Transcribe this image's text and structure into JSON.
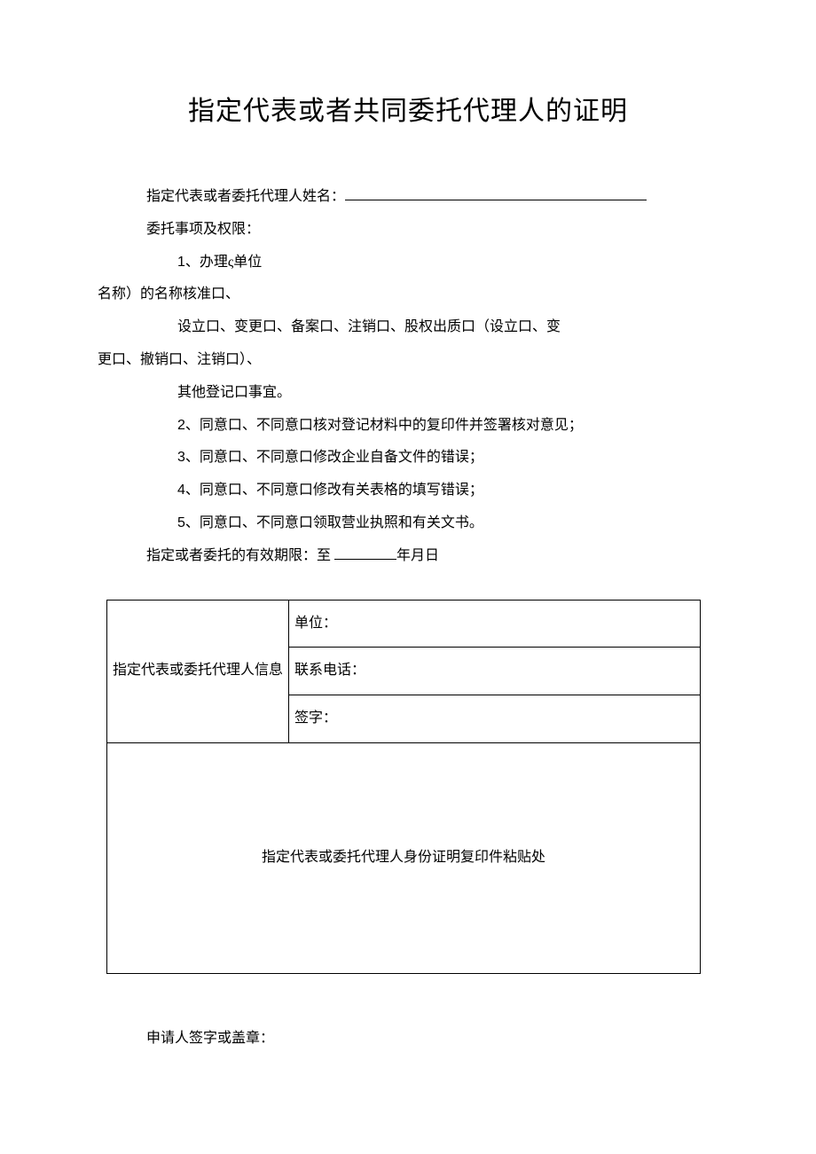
{
  "title": "指定代表或者共同委托代理人的证明",
  "lines": {
    "name_label": "指定代表或者委托代理人姓名：",
    "entrust_label": "委托事项及权限：",
    "item1_a": "1、办理ς单位",
    "item1_b": "名称）的名称核准口、",
    "item1_c": "设立口、变更口、备案口、注销口、股权出质口（设立口、变",
    "item1_d": "更口、撤销口、注销口）、",
    "item1_e": "其他登记口事宜。",
    "item2": "2、同意口、不同意口核对登记材料中的复印件并签署核对意见；",
    "item3": "3、同意口、不同意口修改企业自备文件的错误；",
    "item4": "4、同意口、不同意口修改有关表格的填写错误；",
    "item5": "5、同意口、不同意口领取营业执照和有关文书。",
    "term_a": "指定或者委托的有效期限：至 ",
    "term_b": "年月日"
  },
  "table": {
    "header": "指定代表或委托代理人信息",
    "unit": "单位：",
    "phone": "联系电话：",
    "sign": "签字：",
    "paste": "指定代表或委托代理人身份证明复印件粘贴处"
  },
  "footer": "申请人签字或盖章："
}
